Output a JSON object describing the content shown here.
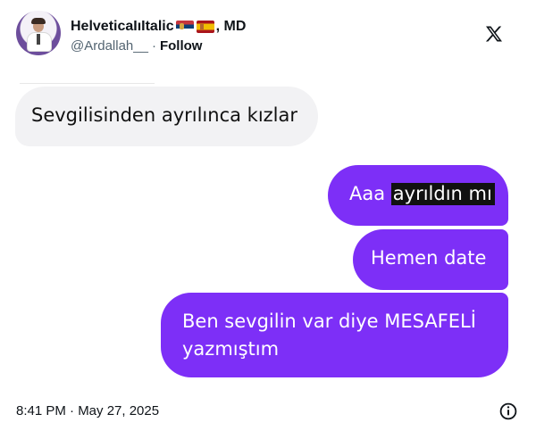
{
  "tweet": {
    "author": {
      "display_name_prefix": "HelveticaIıItalic",
      "display_name_suffix": ", MD",
      "handle": "@Ardallah__",
      "separator": "·",
      "follow_label": "Follow"
    },
    "icons": {
      "brand": "x-logo-icon",
      "serbia_flag": "serbia-flag-icon",
      "spain_flag": "spain-flag-icon",
      "info": "info-icon"
    },
    "timestamp": "8:41 PM · May 27, 2025"
  },
  "chat": {
    "incoming_message": "Sevgilisinden ayrılınca kızlar",
    "outgoing_messages": {
      "first_prefix": "Aaa ",
      "first_highlight": "ayrıldın mı",
      "second": "Hemen date",
      "third": "Ben sevgilin var diye MESAFELİ yazmıştım"
    }
  },
  "colors": {
    "outgoing_bubble": "#7d2ff7",
    "incoming_bubble": "#f2f2f4",
    "highlight": "#111111",
    "text": "#0f1419",
    "secondary_text": "#536471"
  }
}
